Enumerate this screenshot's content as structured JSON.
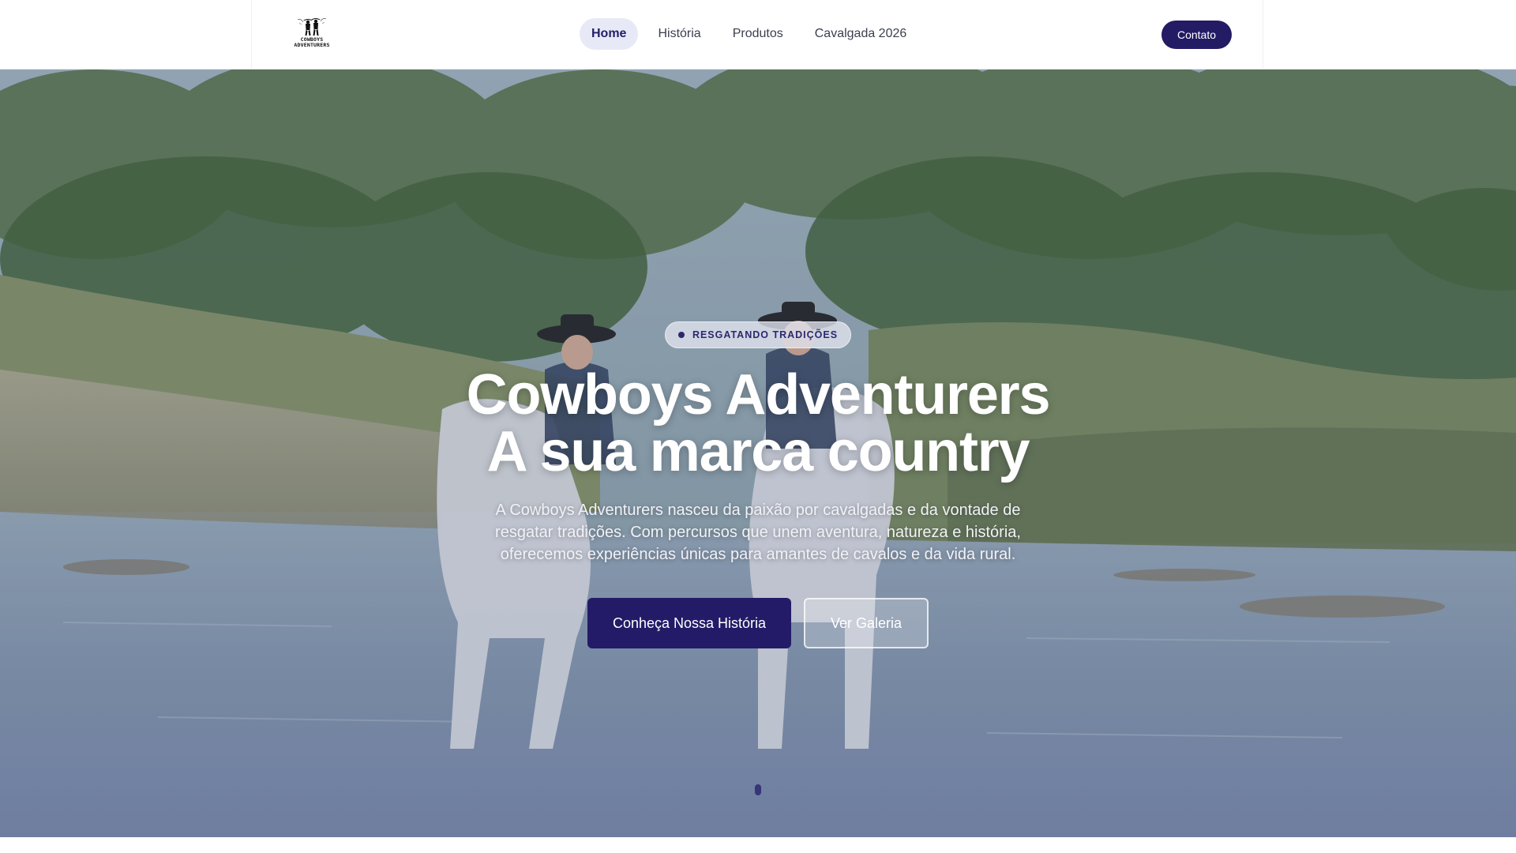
{
  "header": {
    "logo": {
      "line1": "COWBOYS",
      "line2": "ADVENTURERS"
    },
    "nav": [
      {
        "label": "Home",
        "active": true
      },
      {
        "label": "História",
        "active": false
      },
      {
        "label": "Produtos",
        "active": false
      },
      {
        "label": "Cavalgada 2026",
        "active": false
      }
    ],
    "contact_label": "Contato"
  },
  "hero": {
    "badge": "RESGATANDO TRADIÇÕES",
    "title_line1": "Cowboys Adventurers",
    "title_line2": "A sua marca country",
    "description": "A Cowboys Adventurers nasceu da paixão por cavalgadas e da vontade de resgatar tradições. Com percursos que unem aventura, natureza e história, oferecemos experiências únicas para amantes de cavalos e da vida rural.",
    "primary_button": "Conheça Nossa História",
    "secondary_button": "Ver Galeria",
    "background": "two-cowboys-on-white-horses-in-river-photo"
  },
  "colors": {
    "brand": "#241b68",
    "nav_active_bg": "#e8e9f6",
    "header_bg": "#ffffff"
  }
}
